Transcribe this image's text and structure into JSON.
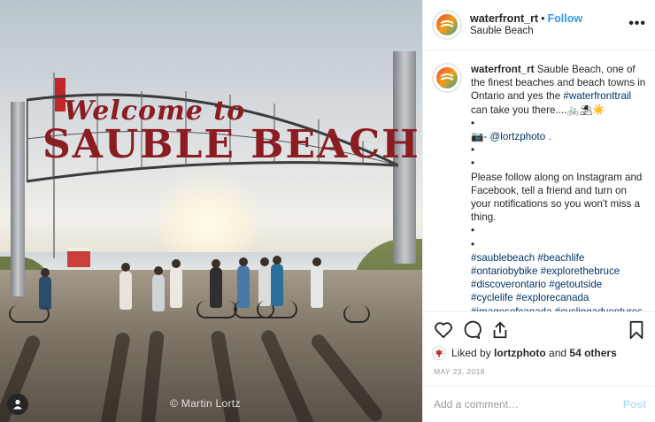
{
  "photo": {
    "sign_line1": "Welcome to",
    "sign_line2": "SAUBLE BEACH",
    "watermark": "© Martin Lortz",
    "user_tag_icon": "person-icon"
  },
  "header": {
    "username": "waterfront_rt",
    "separator": "•",
    "follow_label": "Follow",
    "location": "Sauble Beach",
    "more_icon": "more-options-icon",
    "more_label": "•••"
  },
  "caption": {
    "username": "waterfront_rt",
    "text1": "Sauble Beach, one of the finest beaches and beach towns in Ontario and yes the",
    "hashtag1": "#waterfronttrail",
    "text2": "can take you there....🚲⛱☀️",
    "bullet": "•",
    "credit_prefix": "📷-",
    "credit_handle": "@lortzphoto",
    "credit_suffix": ".",
    "text3": "Please follow along on Instagram and Facebook, tell a friend and turn on your notifications so you won't miss a thing.",
    "hashtags": "#saublebeach #beachlife #ontariobybike #explorethebruce #discoverontario #getoutside #cyclelife #explorecanada #imagesofcanada #cyclingadventures #adventurebybike #cycletouring #biketouring #fitness"
  },
  "actions": {
    "like_icon": "heart-icon",
    "comment_icon": "comment-icon",
    "share_icon": "share-icon",
    "save_icon": "bookmark-icon"
  },
  "likes": {
    "prefix": "Liked by",
    "user": "lortzphoto",
    "conj": "and",
    "others": "54 others"
  },
  "date": "MAY 23, 2018",
  "comment": {
    "placeholder": "Add a comment…",
    "post_label": "Post"
  },
  "colors": {
    "link": "#3897f0",
    "hashtag": "#003569",
    "sign_red": "#8b1c22",
    "post_disabled": "#b2dffc"
  }
}
